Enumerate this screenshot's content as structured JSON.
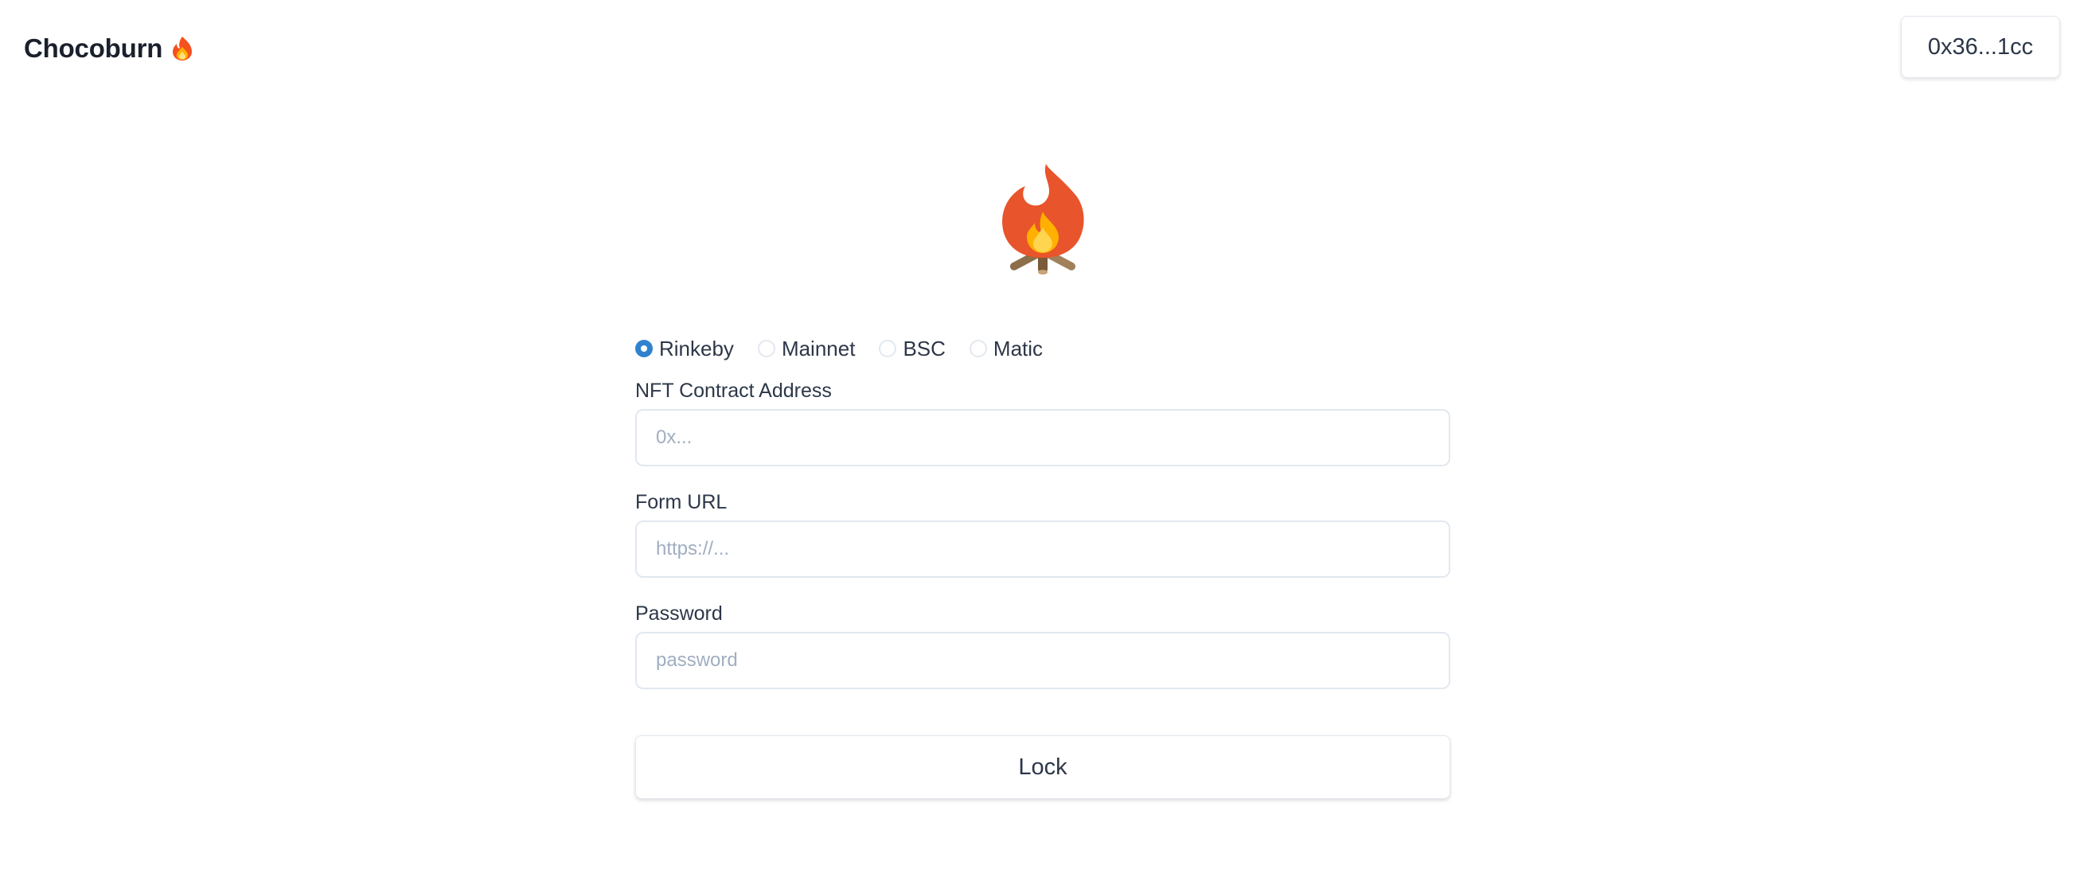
{
  "header": {
    "brand": "Chocoburn",
    "brand_icon": "fire-icon",
    "wallet_address": "0x36...1cc"
  },
  "hero": {
    "icon": "campfire-icon"
  },
  "networks": {
    "selected": "Rinkeby",
    "options": [
      "Rinkeby",
      "Mainnet",
      "BSC",
      "Matic"
    ]
  },
  "fields": {
    "contract": {
      "label": "NFT Contract Address",
      "placeholder": "0x...",
      "value": ""
    },
    "form_url": {
      "label": "Form URL",
      "placeholder": "https://...",
      "value": ""
    },
    "password": {
      "label": "Password",
      "placeholder": "password",
      "value": ""
    }
  },
  "actions": {
    "lock_label": "Lock"
  },
  "colors": {
    "accent": "#3182ce",
    "flame_outer": "#e8542b",
    "flame_inner": "#ffc53d"
  }
}
